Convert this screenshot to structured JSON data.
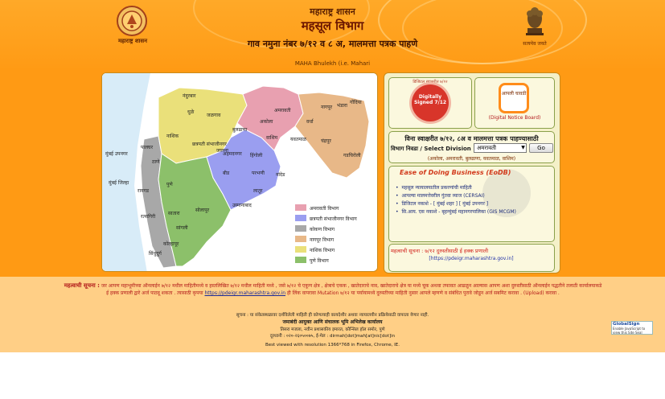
{
  "header": {
    "seal_caption": "महाराष्ट्र शासन",
    "line1": "महाराष्ट्र शासन",
    "line2": "महसूल विभाग",
    "line3": "गाव नमुना नंबर ७/१२ व ८ अ, मालमत्ता पत्रक पाहणे",
    "line4": "MAHA Bhulekh (i.e. Mahari",
    "emblem_caption": "सत्यमेव जयते"
  },
  "map": {
    "cities": [
      "नंदुरबार",
      "धुळे",
      "जळगाव",
      "नाशिक",
      "बुलढाणा",
      "अकोला",
      "अमरावती",
      "नागपूर",
      "भंडारा",
      "गोंदिया",
      "वर्धा",
      "वाशिम",
      "यवतमाळ",
      "चंद्रपूर",
      "गडचिरोली",
      "पालघर",
      "ठाणे",
      "मुंबई उपनगर",
      "मुंबई जिल्हा",
      "रायगड",
      "पुणे",
      "अहमदनगर",
      "छत्रपती संभाजीनगर",
      "जालना",
      "हिंगोली",
      "परभणी",
      "नांदेड",
      "बीड",
      "लातूर",
      "उस्मानाबाद",
      "सोलापूर",
      "सातारा",
      "सांगली",
      "रत्नागिरी",
      "कोल्हापूर",
      "सिंधुदुर्ग"
    ],
    "legend": [
      {
        "label": "अमरावती विभाग",
        "color": "#e8a0b0"
      },
      {
        "label": "छत्रपती संभाजीनगर विभाग",
        "color": "#9a9ef0"
      },
      {
        "label": "कोकण विभाग",
        "color": "#a8a8a8"
      },
      {
        "label": "नागपूर विभाग",
        "color": "#e8b888"
      },
      {
        "label": "नाशिक विभाग",
        "color": "#eae07a"
      },
      {
        "label": "पुणे विभाग",
        "color": "#8cc06a"
      }
    ]
  },
  "signed_card": {
    "ring_text": "डिजिटल स्वाक्षरीत ७/१२",
    "badge": "Digitally Signed 7/12"
  },
  "notice_card": {
    "icon_text": "आपली चावडी",
    "caption": "(Digital Notice Board)"
  },
  "select_card": {
    "title": "विना स्वाक्षरीत ७/१२, ८अ व मालमत्ता पत्रक पाहण्यासाठी",
    "label": "विभाग निवडा / Select Division",
    "selected": "अमरावती",
    "go_label": "Go",
    "subtitle": "(अकोला, अमरावती, बुलढाणा, यवतमाळ, वाशिम)"
  },
  "ease_card": {
    "title": "Ease of Doing Business (EoDB)",
    "items": [
      "महसूल न्यायालयातील प्रकरणांची माहिती",
      "आपल्या मालमत्तेवरील गुंतवा व्याज (CERSAI)",
      "डिजिटल नकाशे - [ मुंबई शहर ] [ मुंबई उपनगर ]",
      "सि.आय. एस नकाशे - बृहन्मुंबई महानगरपालिका (GIS MCGM)"
    ]
  },
  "note_card": {
    "title": "महत्वाची सूचना : ७/१२ दुरुस्तीसाठी ई हक्क प्रणाली",
    "link": "[https://pdeigr.maharashtra.gov.in]"
  },
  "footer": {
    "notice_lead": "महत्वाची सूचना :",
    "notice_body": "जर आपण महाभूमीच्या ऑनलाईन ७/१२ मधील माहितीमध्ये व हस्तलिखित ७/१२ मधील माहिती मध्ये , जसे ७/१२ चे एकूण क्षेत्र , क्षेत्राचे एकक , खातेदाराचे नाव, खातेदाराचे क्षेत्र या मध्ये चूक अथवा तफावत आढळून आल्यास आपण अशा दुरुस्तीसाठी ऑनलाईन पद्धतीने तलाठी कार्यालयाकडे ई हक्क प्रणाली द्वारे अर्ज पाठवू शकता . त्यासाठी कृपया",
    "notice_link": "https://pdeigr.maharashtra.gov.in",
    "notice_tail": "ही लिंक वापरावा Mutation ७/१२ या पर्यायामध्ये दुरुस्तीच्या माहिती नुसार आपले म्हणणे व संबंधित पुरावे जोडून अर्ज सबमिट करावा . (Upload) करावा .",
    "disclaimer": "सूचना : या संकेतस्थळावर दर्शविलेली माहिती ही कोणत्याही कायदेशीर अथवा न्यायालयीन प्रक्रियेसाठी वापरता येणार नाही.",
    "dept": "जमाबंदी आयुक्त आणि संचालक भूमि अभिलेख कार्यालय",
    "address": "तिसरा मजला, नवीन प्रशासकीय इमारत, कौन्सिल हॉल समोर, पुणे",
    "phone": "दूरध्वनी : ०२०-२६०५००७५, ई-मेल : dirmah[dot]mah[at]nic[dot]in",
    "best_viewed": "Best viewed with resolution 1366*768 in Firefox, Chrome, IE.",
    "globalsign_title": "GlobalSign",
    "globalsign_sub": "Enable JavaScript to view this Site Seal"
  }
}
